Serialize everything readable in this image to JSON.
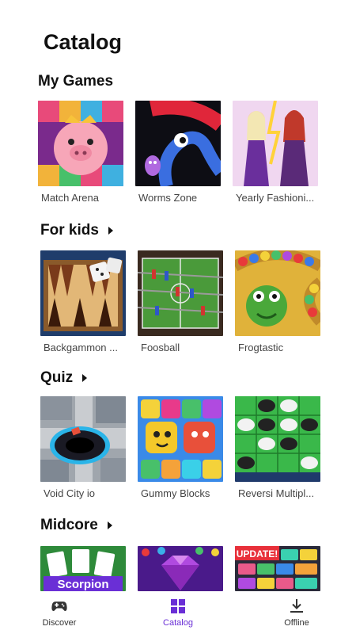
{
  "page": {
    "title": "Catalog"
  },
  "sections": [
    {
      "title": "My Games",
      "has_arrow": false,
      "games": [
        {
          "name": "Match Arena"
        },
        {
          "name": "Worms Zone"
        },
        {
          "name": "Yearly Fashioni..."
        }
      ]
    },
    {
      "title": "For kids",
      "has_arrow": true,
      "games": [
        {
          "name": "Backgammon ..."
        },
        {
          "name": "Foosball"
        },
        {
          "name": "Frogtastic"
        }
      ]
    },
    {
      "title": "Quiz",
      "has_arrow": true,
      "games": [
        {
          "name": "Void City io"
        },
        {
          "name": "Gummy Blocks"
        },
        {
          "name": "Reversi Multipl..."
        }
      ]
    },
    {
      "title": "Midcore",
      "has_arrow": true,
      "games": [
        {
          "name": ""
        },
        {
          "name": ""
        },
        {
          "name": ""
        }
      ]
    }
  ],
  "thumb_text": {
    "scorpion": "Scorpion",
    "update": "UPDATE!"
  },
  "nav": [
    {
      "label": "Discover",
      "icon": "gamepad-icon",
      "active": false
    },
    {
      "label": "Catalog",
      "icon": "grid-icon",
      "active": true
    },
    {
      "label": "Offline",
      "icon": "download-icon",
      "active": false
    }
  ],
  "colors": {
    "accent": "#6a2fd6",
    "text": "#111111",
    "caption": "#444444"
  }
}
